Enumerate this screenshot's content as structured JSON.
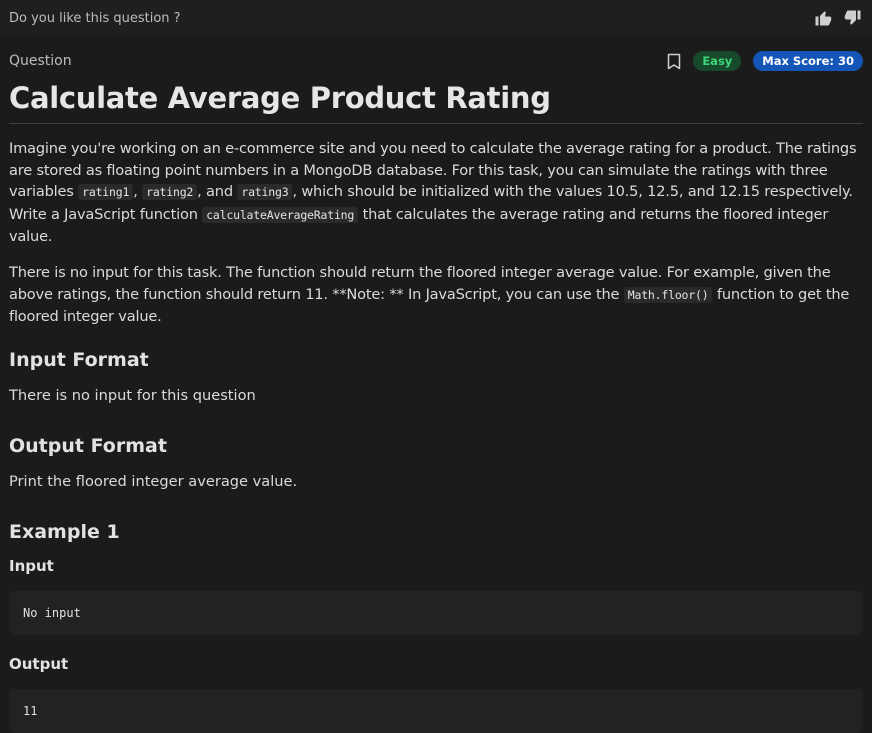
{
  "feedback": {
    "prompt": "Do you like this question ?",
    "like_icon": "thumbs-up-icon",
    "dislike_icon": "thumbs-down-icon"
  },
  "question": {
    "label": "Question",
    "difficulty": "Easy",
    "max_score": "Max Score: 30",
    "title": "Calculate Average Product Rating",
    "bookmark_icon": "bookmark-icon"
  },
  "description": {
    "p1_a": "Imagine you're working on an e-commerce site and you need to calculate the average rating for a product. The ratings are stored as floating point numbers in a MongoDB database. For this task, you can simulate the ratings with three variables ",
    "code1": "rating1",
    "p1_b": ", ",
    "code2": "rating2",
    "p1_c": ", and ",
    "code3": "rating3",
    "p1_d": ", which should be initialized with the values 10.5, 12.5, and 12.15 respectively. Write a JavaScript function ",
    "code4": "calculateAverageRating",
    "p1_e": " that calculates the average rating and returns the floored integer value.",
    "p2_a": "There is no input for this task. The function should return the floored integer average value. For example, given the above ratings, the function should return 11. **Note: ** In JavaScript, you can use the ",
    "code5": "Math.floor()",
    "p2_b": " function to get the floored integer value."
  },
  "input_format": {
    "heading": "Input Format",
    "text": "There is no input for this question"
  },
  "output_format": {
    "heading": "Output Format",
    "text": "Print the floored integer average value."
  },
  "example": {
    "heading": "Example 1",
    "input_label": "Input",
    "input_value": "No input",
    "output_label": "Output",
    "output_value": "11"
  },
  "colors": {
    "background": "#1b1b1c",
    "easy_badge_bg": "#174a2b",
    "easy_badge_text": "#3bd778",
    "score_badge_bg": "#1456b8"
  }
}
